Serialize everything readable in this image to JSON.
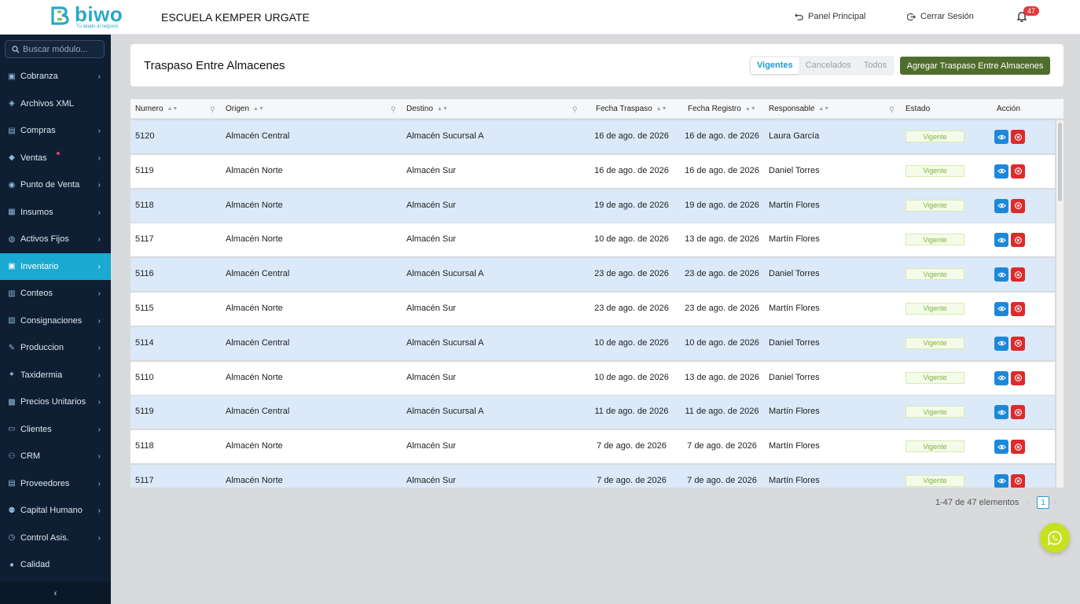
{
  "brand": {
    "name": "biwo",
    "tagline": "Tu aliado al negocio",
    "color": "#2aa8c6"
  },
  "header": {
    "company": "ESCUELA KEMPER URGATE",
    "panel_principal": "Panel Principal",
    "cerrar_sesion": "Cerrar Sesión",
    "notifications_count": "47"
  },
  "sidebar": {
    "search_placeholder": "Buscar módulo...",
    "items": [
      {
        "label": "Cobranza",
        "icon": "cash-icon"
      },
      {
        "label": "Archivos XML",
        "icon": "xml-icon"
      },
      {
        "label": "Compras",
        "icon": "cart-icon"
      },
      {
        "label": "Ventas",
        "icon": "tag-icon"
      },
      {
        "label": "Punto de Venta",
        "icon": "pos-icon"
      },
      {
        "label": "Insumos",
        "icon": "box-icon"
      },
      {
        "label": "Activos Fijos",
        "icon": "asset-icon"
      },
      {
        "label": "Inventario",
        "icon": "inventory-icon"
      },
      {
        "label": "Conteos",
        "icon": "count-icon"
      },
      {
        "label": "Consignaciones",
        "icon": "consign-icon"
      },
      {
        "label": "Produccion",
        "icon": "wrench-icon"
      },
      {
        "label": "Taxidermia",
        "icon": "taxidermy-icon"
      },
      {
        "label": "Precios Unitarios",
        "icon": "price-icon"
      },
      {
        "label": "Clientes",
        "icon": "clients-icon"
      },
      {
        "label": "CRM",
        "icon": "crm-icon"
      },
      {
        "label": "Proveedores",
        "icon": "supplier-icon"
      },
      {
        "label": "Capital Humano",
        "icon": "people-icon"
      },
      {
        "label": "Control Asis.",
        "icon": "clock-icon"
      },
      {
        "label": "Calidad",
        "icon": "quality-icon"
      }
    ],
    "active": "Inventario"
  },
  "page": {
    "title": "Traspaso Entre Almacenes",
    "filters": [
      "Vigentes",
      "Cancelados",
      "Todos"
    ],
    "active_filter": "Vigentes",
    "add_button": "Agregar Traspaso Entre Almacenes"
  },
  "table": {
    "columns": {
      "numero": "Numero",
      "origen": "Origen",
      "destino": "Destino",
      "fecha_traspaso": "Fecha Traspaso",
      "fecha_registro": "Fecha Registro",
      "responsable": "Responsable",
      "estado": "Estado",
      "accion": "Acción"
    },
    "rows": [
      {
        "numero": "5120",
        "origen": "Almacén Central",
        "destino": "Almacén Sucursal A",
        "fecha_traspaso": "16 de ago. de 2026",
        "fecha_registro": "16 de ago. de 2026",
        "responsable": "Laura García",
        "estado": "Vigente"
      },
      {
        "numero": "5119",
        "origen": "Almacén Norte",
        "destino": "Almacén Sur",
        "fecha_traspaso": "16 de ago. de 2026",
        "fecha_registro": "16 de ago. de 2026",
        "responsable": "Daniel Torres",
        "estado": "Vigente"
      },
      {
        "numero": "5118",
        "origen": "Almacén Norte",
        "destino": "Almacén Sur",
        "fecha_traspaso": "19 de ago. de 2026",
        "fecha_registro": "19 de ago. de 2026",
        "responsable": "Martín Flores",
        "estado": "Vigente"
      },
      {
        "numero": "5117",
        "origen": "Almacén Norte",
        "destino": "Almacén Sur",
        "fecha_traspaso": "10 de ago. de 2026",
        "fecha_registro": "13 de ago. de 2026",
        "responsable": "Martín Flores",
        "estado": "Vigente"
      },
      {
        "numero": "5116",
        "origen": "Almacén Central",
        "destino": "Almacén Sucursal A",
        "fecha_traspaso": "23 de ago. de 2026",
        "fecha_registro": "23 de ago. de 2026",
        "responsable": "Daniel Torres",
        "estado": "Vigente"
      },
      {
        "numero": "5115",
        "origen": "Almacén Norte",
        "destino": "Almacén Sur",
        "fecha_traspaso": "23 de ago. de 2026",
        "fecha_registro": "23 de ago. de 2026",
        "responsable": "Martín Flores",
        "estado": "Vigente"
      },
      {
        "numero": "5114",
        "origen": "Almacén Central",
        "destino": "Almacén Sucursal A",
        "fecha_traspaso": "10 de ago. de 2026",
        "fecha_registro": "10 de ago. de 2026",
        "responsable": "Daniel Torres",
        "estado": "Vigente"
      },
      {
        "numero": "5110",
        "origen": "Almacén Norte",
        "destino": "Almacén Sur",
        "fecha_traspaso": "10 de ago. de 2026",
        "fecha_registro": "13 de ago. de 2026",
        "responsable": "Daniel Torres",
        "estado": "Vigente"
      },
      {
        "numero": "5119",
        "origen": "Almacén Central",
        "destino": "Almacén Sucursal A",
        "fecha_traspaso": "11 de ago. de 2026",
        "fecha_registro": "11 de ago. de 2026",
        "responsable": "Martín Flores",
        "estado": "Vigente"
      },
      {
        "numero": "5118",
        "origen": "Almacén Norte",
        "destino": "Almacén Sur",
        "fecha_traspaso": "7 de ago. de 2026",
        "fecha_registro": "7 de ago. de 2026",
        "responsable": "Martín Flores",
        "estado": "Vigente"
      },
      {
        "numero": "5117",
        "origen": "Almacén Norte",
        "destino": "Almacén Sur",
        "fecha_traspaso": "7 de ago. de 2026",
        "fecha_registro": "7 de ago. de 2026",
        "responsable": "Martín Flores",
        "estado": "Vigente"
      }
    ]
  },
  "pagination": {
    "info": "1-47 de 47 elementos",
    "current_page": "1"
  },
  "colors": {
    "sidebar": "#0e1f33",
    "active": "#1aa9d1",
    "add_button": "#4f6e2d",
    "row_alt": "#dbe9f8",
    "status": "#7cb342"
  }
}
